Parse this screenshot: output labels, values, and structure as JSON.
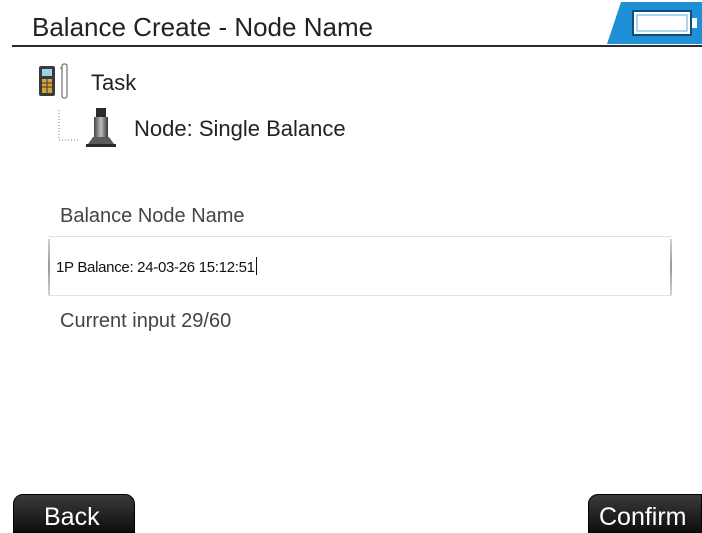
{
  "header": {
    "title": "Balance Create - Node Name",
    "battery_icon": "battery-icon"
  },
  "tree": {
    "task": {
      "label": "Task",
      "icon": "device-icon"
    },
    "node": {
      "label": "Node: Single Balance",
      "icon": "sensor-icon"
    }
  },
  "form": {
    "field_label": "Balance Node Name",
    "value": "1P Balance: 24-03-26 15:12:51",
    "counter": "Current input 29/60"
  },
  "footer": {
    "back_label": "Back",
    "confirm_label": "Confirm"
  },
  "colors": {
    "accent": "#1f8fd6",
    "button_dark": "#1a1a1a"
  }
}
